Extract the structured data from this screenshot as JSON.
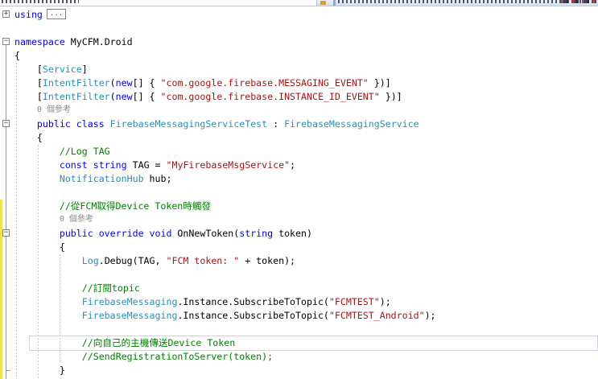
{
  "nav_bar": {
    "note_clipped": true,
    "member_icon": "method-icon"
  },
  "icons": {
    "fold_collapsed": "+",
    "fold_expanded": "−",
    "collapsed_region": "..."
  },
  "colors": {
    "keyword": "#0000ff",
    "type": "#2b91af",
    "string": "#a31515",
    "comment": "#008000",
    "plain": "#000000",
    "codelens_gray": "#8a8a8a",
    "change_bar_yellow": "#f0e14d",
    "member_icon_orange": "#e09a2f"
  },
  "code": {
    "language": "csharp",
    "lines": [
      {
        "fold": "plus",
        "segments": [
          [
            "k",
            "using"
          ],
          [
            "box",
            "..."
          ]
        ]
      },
      {
        "blank": true,
        "segments": []
      },
      {
        "fold": "minus",
        "segments": [
          [
            "k",
            "namespace"
          ],
          [
            "p",
            " MyCFM.Droid"
          ]
        ]
      },
      {
        "segments": [
          [
            "p",
            "{"
          ]
        ]
      },
      {
        "segments": [
          [
            "p",
            "    ["
          ],
          [
            "t",
            "Service"
          ],
          [
            "p",
            "]"
          ]
        ]
      },
      {
        "segments": [
          [
            "p",
            "    ["
          ],
          [
            "t",
            "IntentFilter"
          ],
          [
            "p",
            "("
          ],
          [
            "k",
            "new"
          ],
          [
            "p",
            "[] { "
          ],
          [
            "s",
            "\"com.google.firebase.MESSAGING_EVENT\""
          ],
          [
            "p",
            " })]"
          ]
        ]
      },
      {
        "segments": [
          [
            "p",
            "    ["
          ],
          [
            "t",
            "IntentFilter"
          ],
          [
            "p",
            "("
          ],
          [
            "k",
            "new"
          ],
          [
            "p",
            "[] { "
          ],
          [
            "s",
            "\"com.google.firebase.INSTANCE_ID_EVENT\""
          ],
          [
            "p",
            " })]"
          ]
        ]
      },
      {
        "codelens": true,
        "pad_cols": 4,
        "segments": [
          [
            "g",
            "0 個參考"
          ]
        ]
      },
      {
        "fold": "minus",
        "segments": [
          [
            "p",
            "    "
          ],
          [
            "k",
            "public class"
          ],
          [
            "p",
            " "
          ],
          [
            "t",
            "FirebaseMessagingServiceTest"
          ],
          [
            "p",
            " : "
          ],
          [
            "t",
            "FirebaseMessagingService"
          ]
        ]
      },
      {
        "segments": [
          [
            "p",
            "    {"
          ]
        ]
      },
      {
        "segments": [
          [
            "c",
            "        //Log TAG"
          ]
        ]
      },
      {
        "segments": [
          [
            "p",
            "        "
          ],
          [
            "k",
            "const"
          ],
          [
            "p",
            " "
          ],
          [
            "k",
            "string"
          ],
          [
            "p",
            " TAG = "
          ],
          [
            "s",
            "\"MyFirebaseMsgService\""
          ],
          [
            "p",
            ";"
          ]
        ]
      },
      {
        "segments": [
          [
            "p",
            "        "
          ],
          [
            "t",
            "NotificationHub"
          ],
          [
            "p",
            " hub;"
          ]
        ]
      },
      {
        "blank": true,
        "segments": []
      },
      {
        "segments": [
          [
            "c",
            "        //從FCM取得Device Token時觸發"
          ]
        ]
      },
      {
        "codelens": true,
        "pad_cols": 8,
        "segments": [
          [
            "g",
            "0 個參考"
          ]
        ]
      },
      {
        "fold": "minus",
        "segments": [
          [
            "p",
            "        "
          ],
          [
            "k",
            "public override void"
          ],
          [
            "p",
            " OnNewToken("
          ],
          [
            "k",
            "string"
          ],
          [
            "p",
            " token)"
          ]
        ]
      },
      {
        "segments": [
          [
            "p",
            "        {"
          ]
        ]
      },
      {
        "segments": [
          [
            "p",
            "            "
          ],
          [
            "t",
            "Log"
          ],
          [
            "p",
            ".Debug(TAG, "
          ],
          [
            "s",
            "\"FCM token: \""
          ],
          [
            "p",
            " + token);"
          ]
        ]
      },
      {
        "blank": true,
        "segments": []
      },
      {
        "segments": [
          [
            "c",
            "            //訂閱topic"
          ]
        ]
      },
      {
        "segments": [
          [
            "p",
            "            "
          ],
          [
            "t",
            "FirebaseMessaging"
          ],
          [
            "p",
            ".Instance.SubscribeToTopic("
          ],
          [
            "s",
            "\"FCMTEST\""
          ],
          [
            "p",
            ");"
          ]
        ]
      },
      {
        "segments": [
          [
            "p",
            "            "
          ],
          [
            "t",
            "FirebaseMessaging"
          ],
          [
            "p",
            ".Instance.SubscribeToTopic("
          ],
          [
            "s",
            "\"FCMTEST_Android\""
          ],
          [
            "p",
            ");"
          ]
        ]
      },
      {
        "blank": true,
        "segments": []
      },
      {
        "current": true,
        "segments": [
          [
            "c",
            "            //向自己的主機傳送Device Token"
          ]
        ]
      },
      {
        "segments": [
          [
            "c",
            "            //SendRegistrationToServer(token);"
          ]
        ]
      },
      {
        "segments": [
          [
            "p",
            "        }"
          ]
        ]
      }
    ]
  }
}
